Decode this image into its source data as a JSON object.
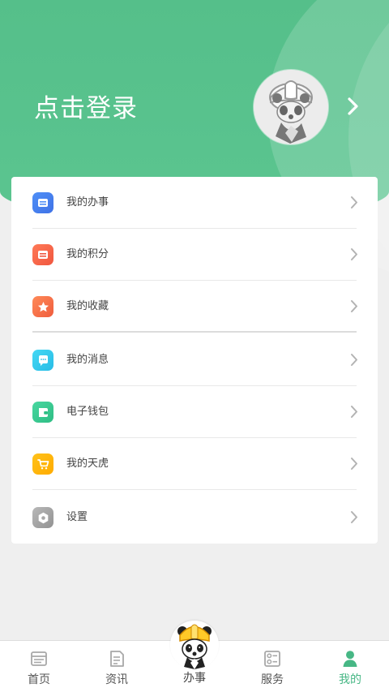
{
  "header": {
    "login_text": "点击登录"
  },
  "menu": {
    "items": [
      {
        "label": "我的办事",
        "icon": "briefcase-icon"
      },
      {
        "label": "我的积分",
        "icon": "points-icon"
      },
      {
        "label": "我的收藏",
        "icon": "star-icon"
      },
      {
        "label": "我的消息",
        "icon": "message-icon"
      },
      {
        "label": "电子钱包",
        "icon": "wallet-icon"
      },
      {
        "label": "我的天虎",
        "icon": "cart-icon"
      },
      {
        "label": "设置",
        "icon": "settings-icon"
      }
    ]
  },
  "tabbar": {
    "home": "首页",
    "news": "资讯",
    "affairs": "办事",
    "service": "服务",
    "mine": "我的"
  },
  "colors": {
    "primary": "#55bf8a",
    "active_tab": "#47b785",
    "page_bg": "#efefef",
    "card_bg": "#ffffff"
  }
}
